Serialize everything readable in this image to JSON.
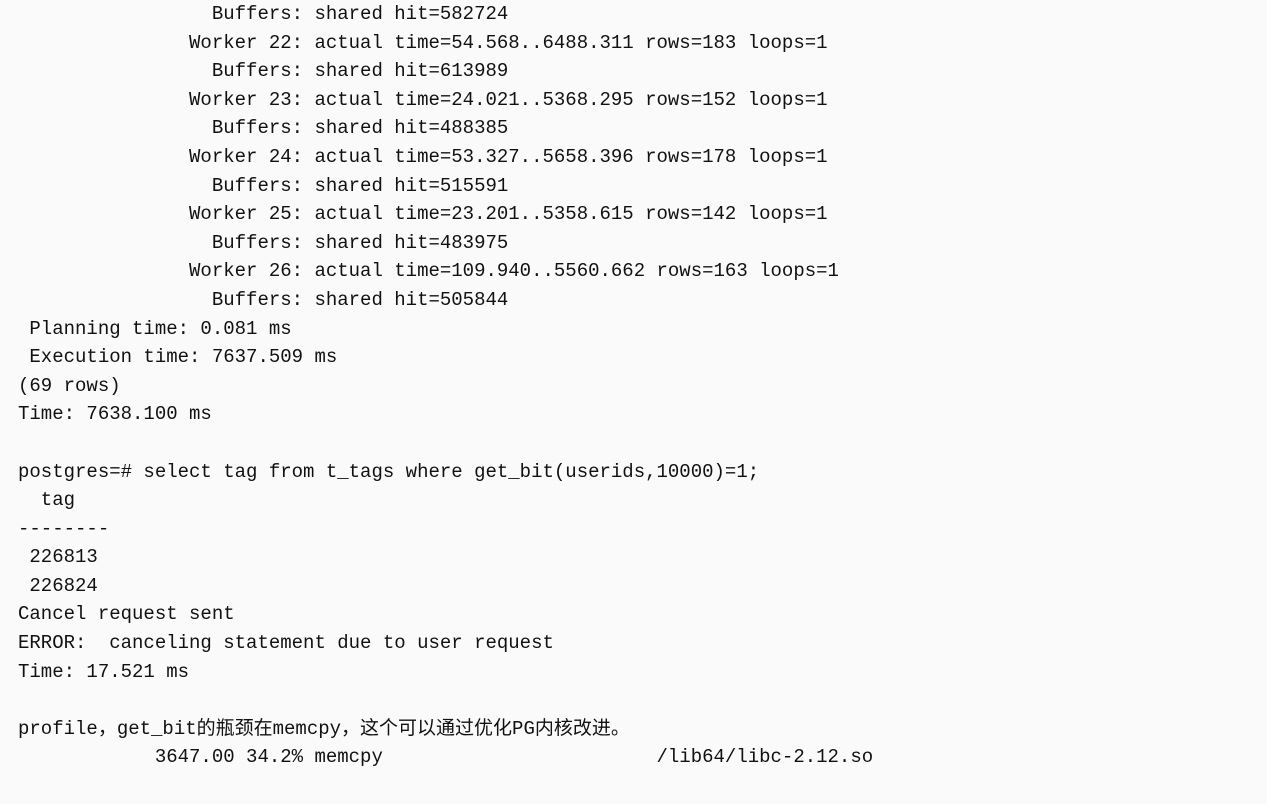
{
  "lines": {
    "l00": "                 Buffers: shared hit=582724",
    "l01": "               Worker 22: actual time=54.568..6488.311 rows=183 loops=1",
    "l02": "                 Buffers: shared hit=613989",
    "l03": "               Worker 23: actual time=24.021..5368.295 rows=152 loops=1",
    "l04": "                 Buffers: shared hit=488385",
    "l05": "               Worker 24: actual time=53.327..5658.396 rows=178 loops=1",
    "l06": "                 Buffers: shared hit=515591",
    "l07": "               Worker 25: actual time=23.201..5358.615 rows=142 loops=1",
    "l08": "                 Buffers: shared hit=483975",
    "l09": "               Worker 26: actual time=109.940..5560.662 rows=163 loops=1",
    "l10": "                 Buffers: shared hit=505844",
    "l11": " Planning time: 0.081 ms",
    "l12": " Execution time: 7637.509 ms",
    "l13": "(69 rows)",
    "l14": "Time: 7638.100 ms",
    "l15": "",
    "l16": "postgres=# select tag from t_tags where get_bit(userids,10000)=1;",
    "l17": "  tag   ",
    "l18": "--------",
    "l19": " 226813",
    "l20": " 226824",
    "l21": "Cancel request sent",
    "l22": "ERROR:  canceling statement due to user request",
    "l23": "Time: 17.521 ms",
    "l24": "",
    "l25": "profile，get_bit的瓶颈在memcpy，这个可以通过优化PG内核改进。",
    "l26": "            3647.00 34.2% memcpy                        /lib64/libc-2.12.so"
  }
}
